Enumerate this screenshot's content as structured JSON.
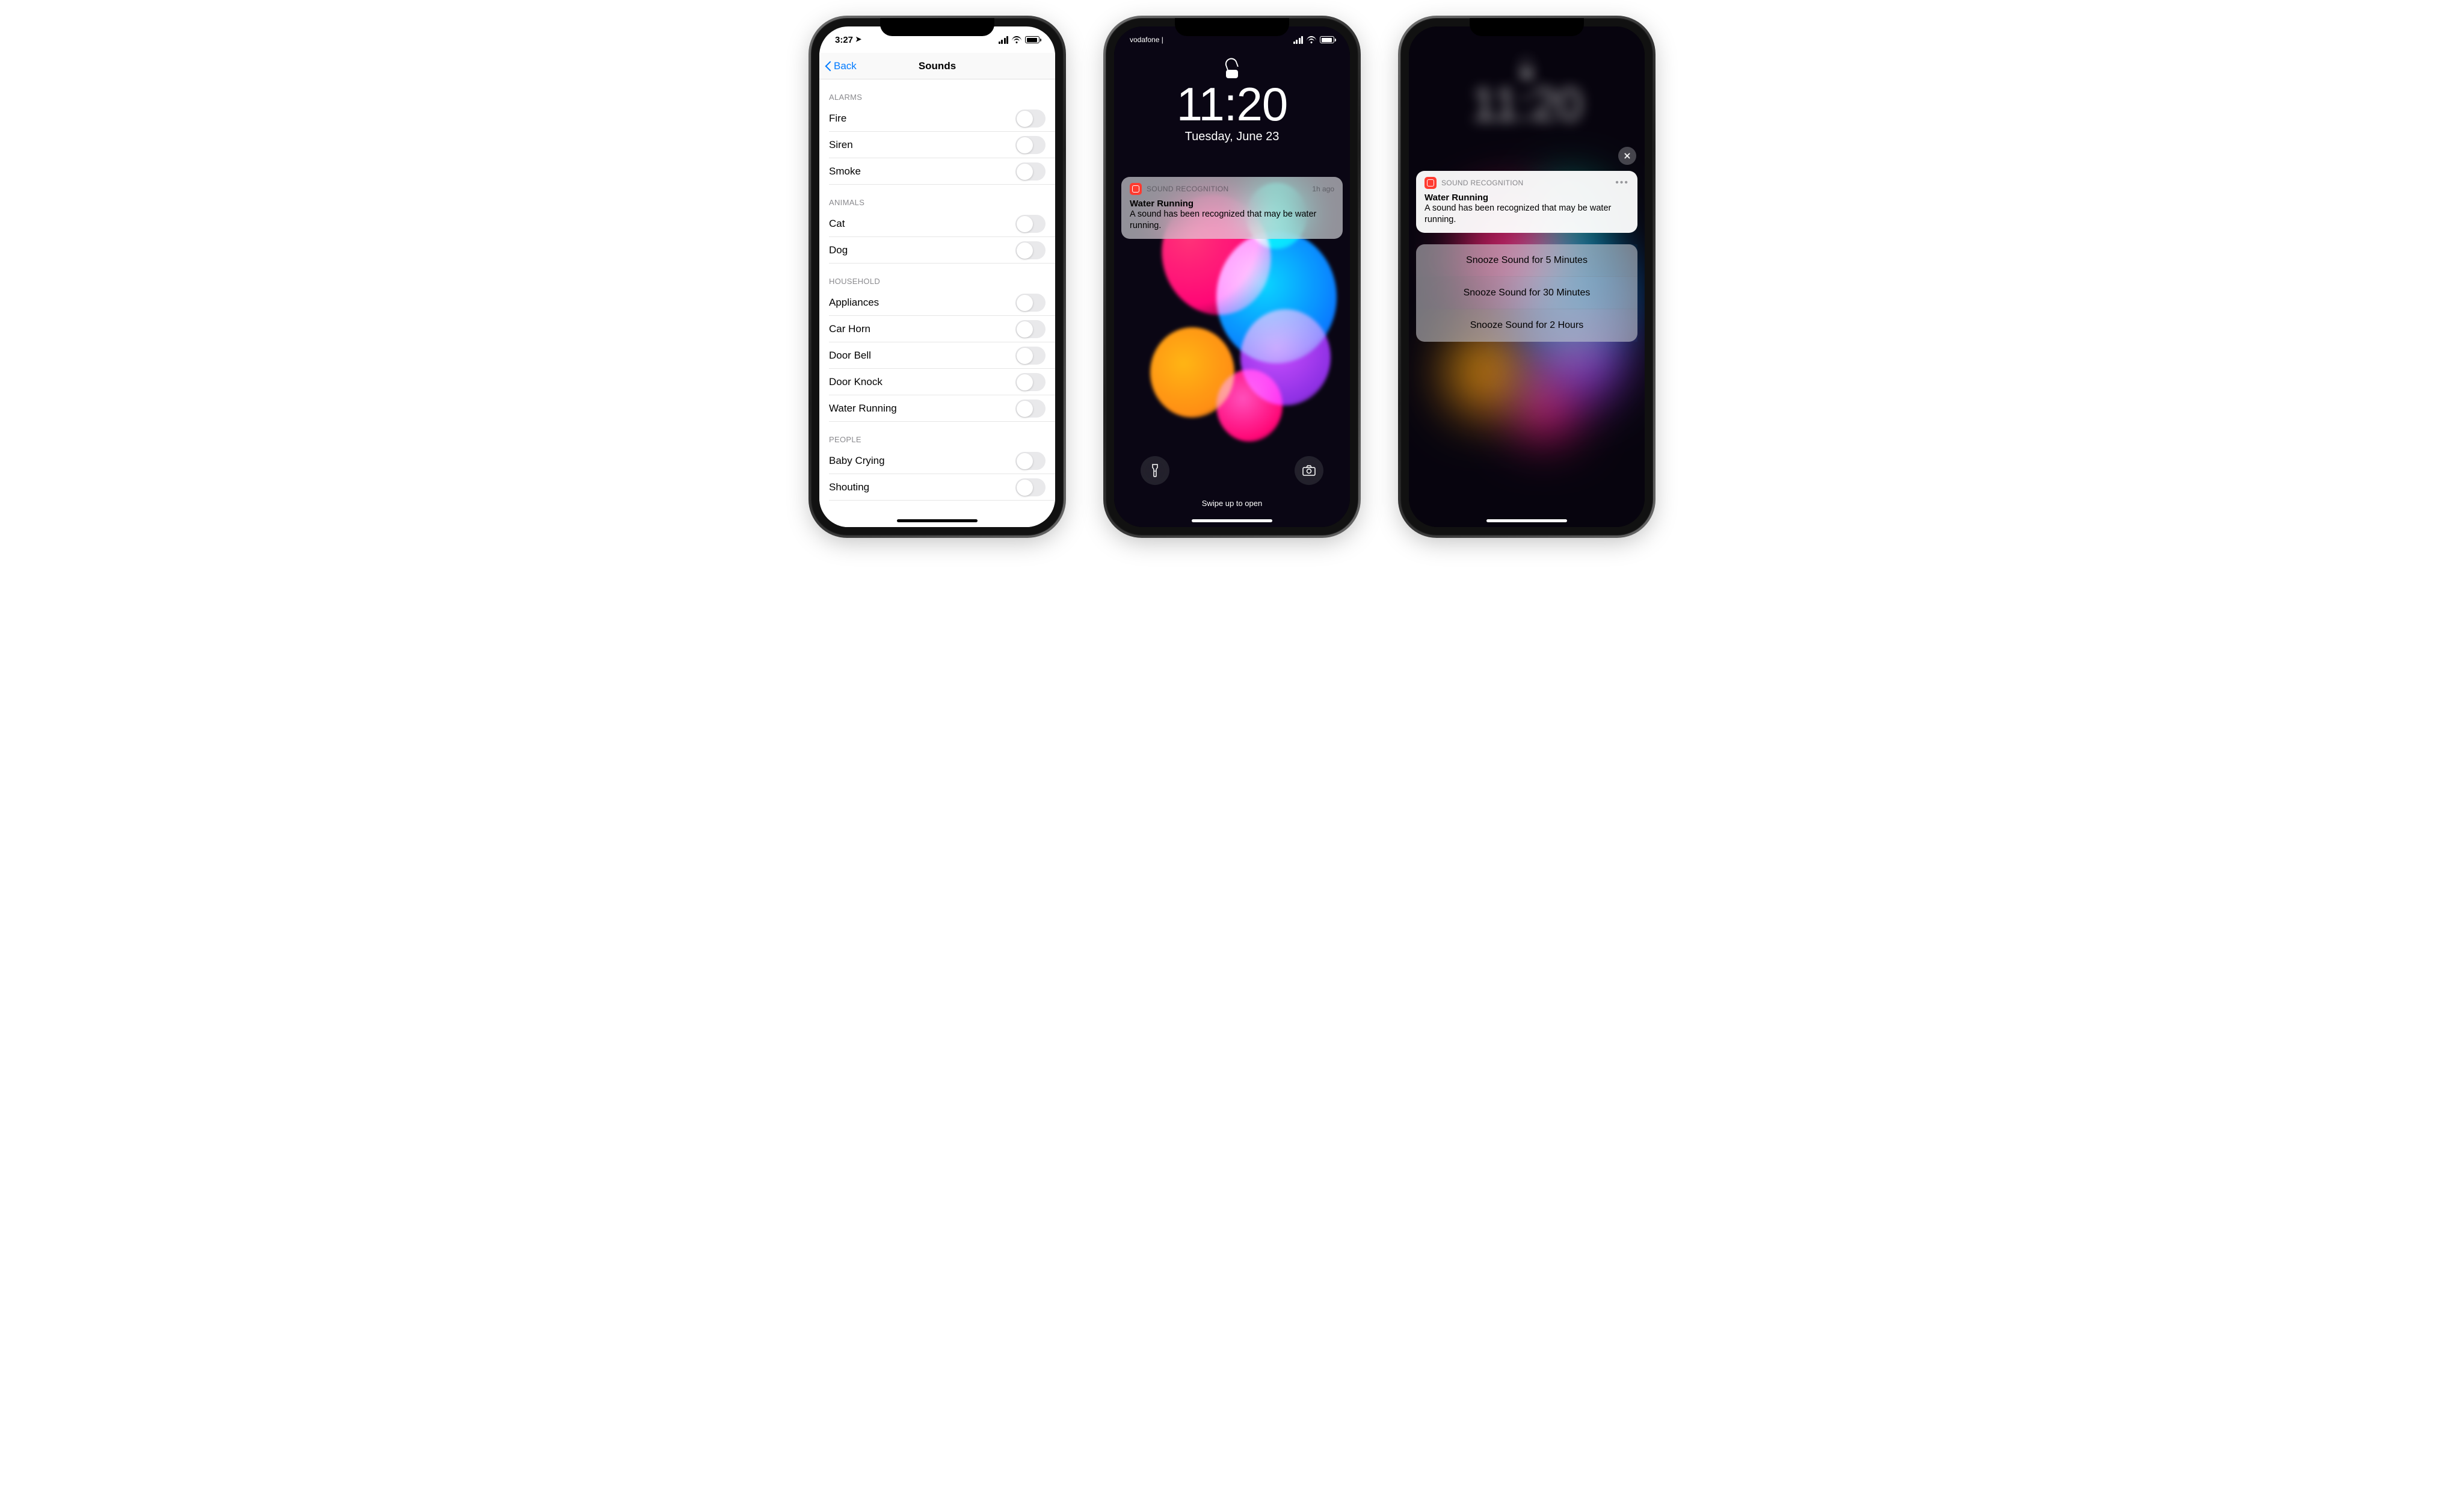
{
  "phone1": {
    "status_time": "3:27",
    "nav_back": "Back",
    "nav_title": "Sounds",
    "sections": {
      "alarms": {
        "header": "ALARMS",
        "items": [
          "Fire",
          "Siren",
          "Smoke"
        ]
      },
      "animals": {
        "header": "ANIMALS",
        "items": [
          "Cat",
          "Dog"
        ]
      },
      "household": {
        "header": "HOUSEHOLD",
        "items": [
          "Appliances",
          "Car Horn",
          "Door Bell",
          "Door Knock",
          "Water Running"
        ]
      },
      "people": {
        "header": "PEOPLE",
        "items": [
          "Baby Crying",
          "Shouting"
        ]
      }
    }
  },
  "phone2": {
    "carrier": "vodafone |",
    "clock": "11:20",
    "date": "Tuesday, June 23",
    "notif_app": "SOUND RECOGNITION",
    "notif_time": "1h ago",
    "notif_title": "Water Running",
    "notif_body": "A sound has been recognized that may be water running.",
    "swipe": "Swipe up to open"
  },
  "phone3": {
    "notif_app": "SOUND RECOGNITION",
    "notif_title": "Water Running",
    "notif_body": "A sound has been recognized that may be water running.",
    "actions": [
      "Snooze Sound for 5 Minutes",
      "Snooze Sound for 30 Minutes",
      "Snooze Sound for 2 Hours"
    ]
  }
}
